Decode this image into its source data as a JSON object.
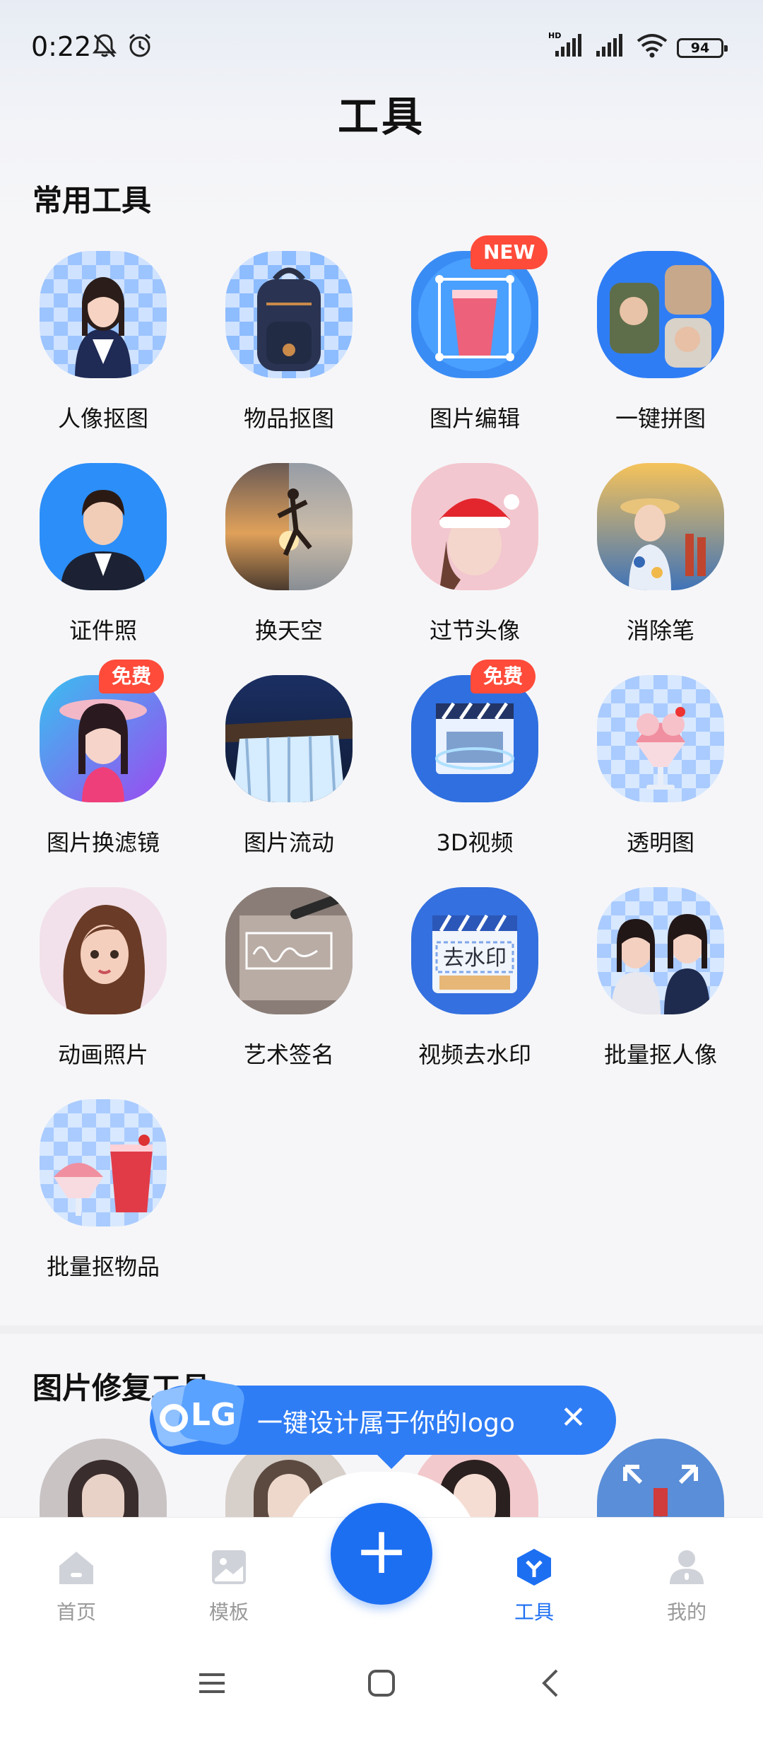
{
  "status_bar": {
    "time": "0:22",
    "battery": "94",
    "icons": [
      "muted-bell-icon",
      "alarm-icon",
      "hd-signal-icon",
      "signal-icon",
      "wifi-icon"
    ]
  },
  "header": {
    "title": "工具"
  },
  "sections": {
    "common": {
      "title": "常用工具"
    },
    "repair": {
      "title": "图片修复工具"
    }
  },
  "tools": [
    {
      "label": "人像抠图"
    },
    {
      "label": "物品抠图"
    },
    {
      "label": "图片编辑",
      "badge": "NEW"
    },
    {
      "label": "一键拼图"
    },
    {
      "label": "证件照"
    },
    {
      "label": "换天空"
    },
    {
      "label": "过节头像"
    },
    {
      "label": "消除笔"
    },
    {
      "label": "图片换滤镜",
      "badge": "免费"
    },
    {
      "label": "图片流动"
    },
    {
      "label": "3D视频",
      "badge": "免费"
    },
    {
      "label": "透明图"
    },
    {
      "label": "动画照片"
    },
    {
      "label": "艺术签名"
    },
    {
      "label": "视频去水印",
      "icon_text": "去水印"
    },
    {
      "label": "批量抠人像"
    },
    {
      "label": "批量抠物品"
    }
  ],
  "promo": {
    "text": "一键设计属于你的logo",
    "close": "✕",
    "logo_text": "LG"
  },
  "bottom_nav": {
    "items": [
      {
        "label": "首页"
      },
      {
        "label": "模板"
      },
      {
        "label": "工具",
        "active": true
      },
      {
        "label": "我的"
      }
    ],
    "fab": "+"
  },
  "colors": {
    "accent": "#1d6ff2",
    "badge": "#ff4b3a"
  }
}
